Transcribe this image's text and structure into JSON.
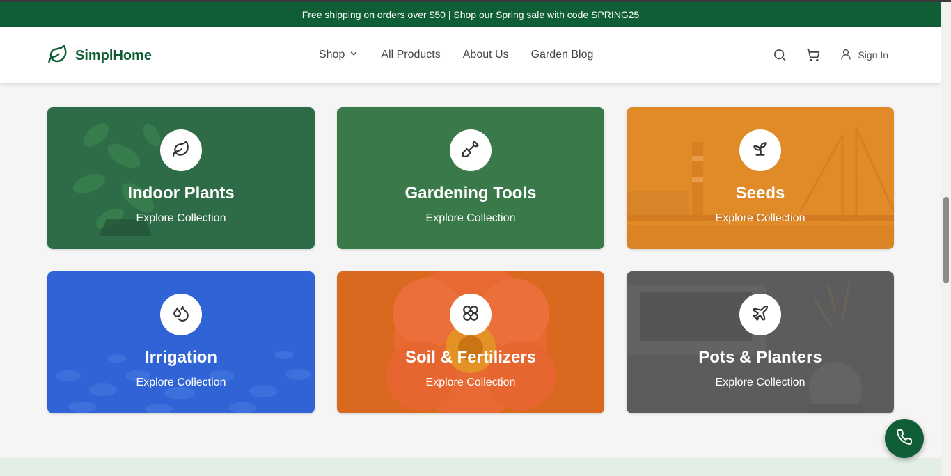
{
  "promo": {
    "text": "Free shipping on orders over $50 | Shop our Spring sale with code SPRING25"
  },
  "brand": {
    "name": "SimplHome",
    "color": "#0f5e36"
  },
  "nav": {
    "shop": "Shop",
    "all_products": "All Products",
    "about": "About Us",
    "blog": "Garden Blog"
  },
  "header_actions": {
    "search_icon": "search-icon",
    "cart_icon": "cart-icon",
    "signin": "Sign In"
  },
  "categories": [
    {
      "title": "Indoor Plants",
      "subtitle": "Explore Collection",
      "icon": "leaf-icon",
      "color": "#2e6b47"
    },
    {
      "title": "Gardening Tools",
      "subtitle": "Explore Collection",
      "icon": "shovel-icon",
      "color": "#3a7a4a"
    },
    {
      "title": "Seeds",
      "subtitle": "Explore Collection",
      "icon": "sprout-icon",
      "color": "#e08a28"
    },
    {
      "title": "Irrigation",
      "subtitle": "Explore Collection",
      "icon": "droplets-icon",
      "color": "#2f63d6"
    },
    {
      "title": "Soil & Fertilizers",
      "subtitle": "Explore Collection",
      "icon": "flower-icon",
      "color": "#d8691e"
    },
    {
      "title": "Pots & Planters",
      "subtitle": "Explore Collection",
      "icon": "plane-icon",
      "color": "#5c5c5c"
    }
  ],
  "call_button": {
    "icon": "phone-icon"
  }
}
